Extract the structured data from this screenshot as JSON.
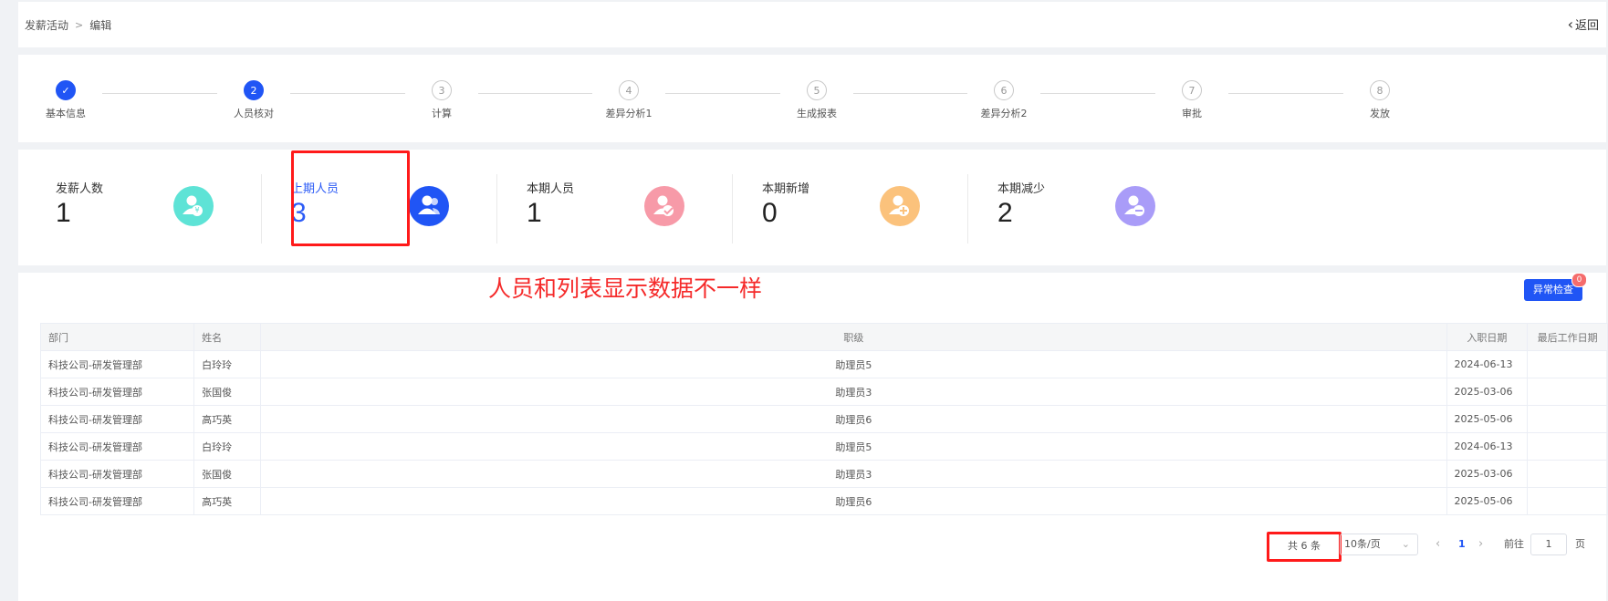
{
  "breadcrumb": {
    "items": [
      "发薪活动",
      "编辑"
    ],
    "back_label": "返回"
  },
  "steps": [
    {
      "num": "✓",
      "label": "基本信息",
      "state": "done"
    },
    {
      "num": "2",
      "label": "人员核对",
      "state": "active"
    },
    {
      "num": "3",
      "label": "计算",
      "state": "todo"
    },
    {
      "num": "4",
      "label": "差异分析1",
      "state": "todo"
    },
    {
      "num": "5",
      "label": "生成报表",
      "state": "todo"
    },
    {
      "num": "6",
      "label": "差异分析2",
      "state": "todo"
    },
    {
      "num": "7",
      "label": "审批",
      "state": "todo"
    },
    {
      "num": "8",
      "label": "发放",
      "state": "todo"
    }
  ],
  "stats": [
    {
      "title": "发薪人数",
      "value": "1",
      "color": "#5ee3d6",
      "icon": "user-money-icon"
    },
    {
      "title": "上期人员",
      "value": "3",
      "color": "#2055f5",
      "icon": "users-icon"
    },
    {
      "title": "本期人员",
      "value": "1",
      "color": "#f79aa8",
      "icon": "user-check-icon"
    },
    {
      "title": "本期新增",
      "value": "0",
      "color": "#fbc27c",
      "icon": "user-add-icon"
    },
    {
      "title": "本期减少",
      "value": "2",
      "color": "#a99cf8",
      "icon": "user-minus-icon"
    }
  ],
  "annotation": "人员和列表显示数据不一样",
  "abnormal_check": {
    "label": "异常检查",
    "badge": "0"
  },
  "table": {
    "columns": [
      "部门",
      "姓名",
      "职级",
      "入职日期",
      "最后工作日期"
    ],
    "rows": [
      [
        "科技公司-研发管理部",
        "白玲玲",
        "助理员5",
        "2024-06-13",
        ""
      ],
      [
        "科技公司-研发管理部",
        "张国俊",
        "助理员3",
        "2025-03-06",
        ""
      ],
      [
        "科技公司-研发管理部",
        "高巧英",
        "助理员6",
        "2025-05-06",
        ""
      ],
      [
        "科技公司-研发管理部",
        "白玲玲",
        "助理员5",
        "2024-06-13",
        ""
      ],
      [
        "科技公司-研发管理部",
        "张国俊",
        "助理员3",
        "2025-03-06",
        ""
      ],
      [
        "科技公司-研发管理部",
        "高巧英",
        "助理员6",
        "2025-05-06",
        ""
      ]
    ]
  },
  "pagination": {
    "total": "共 6 条",
    "page_size": "10条/页",
    "current_page": "1",
    "goto_label": "前往",
    "goto_value": "1",
    "page_unit": "页"
  },
  "colors": {
    "primary": "#2055f5",
    "annotation": "#f52a2a"
  }
}
